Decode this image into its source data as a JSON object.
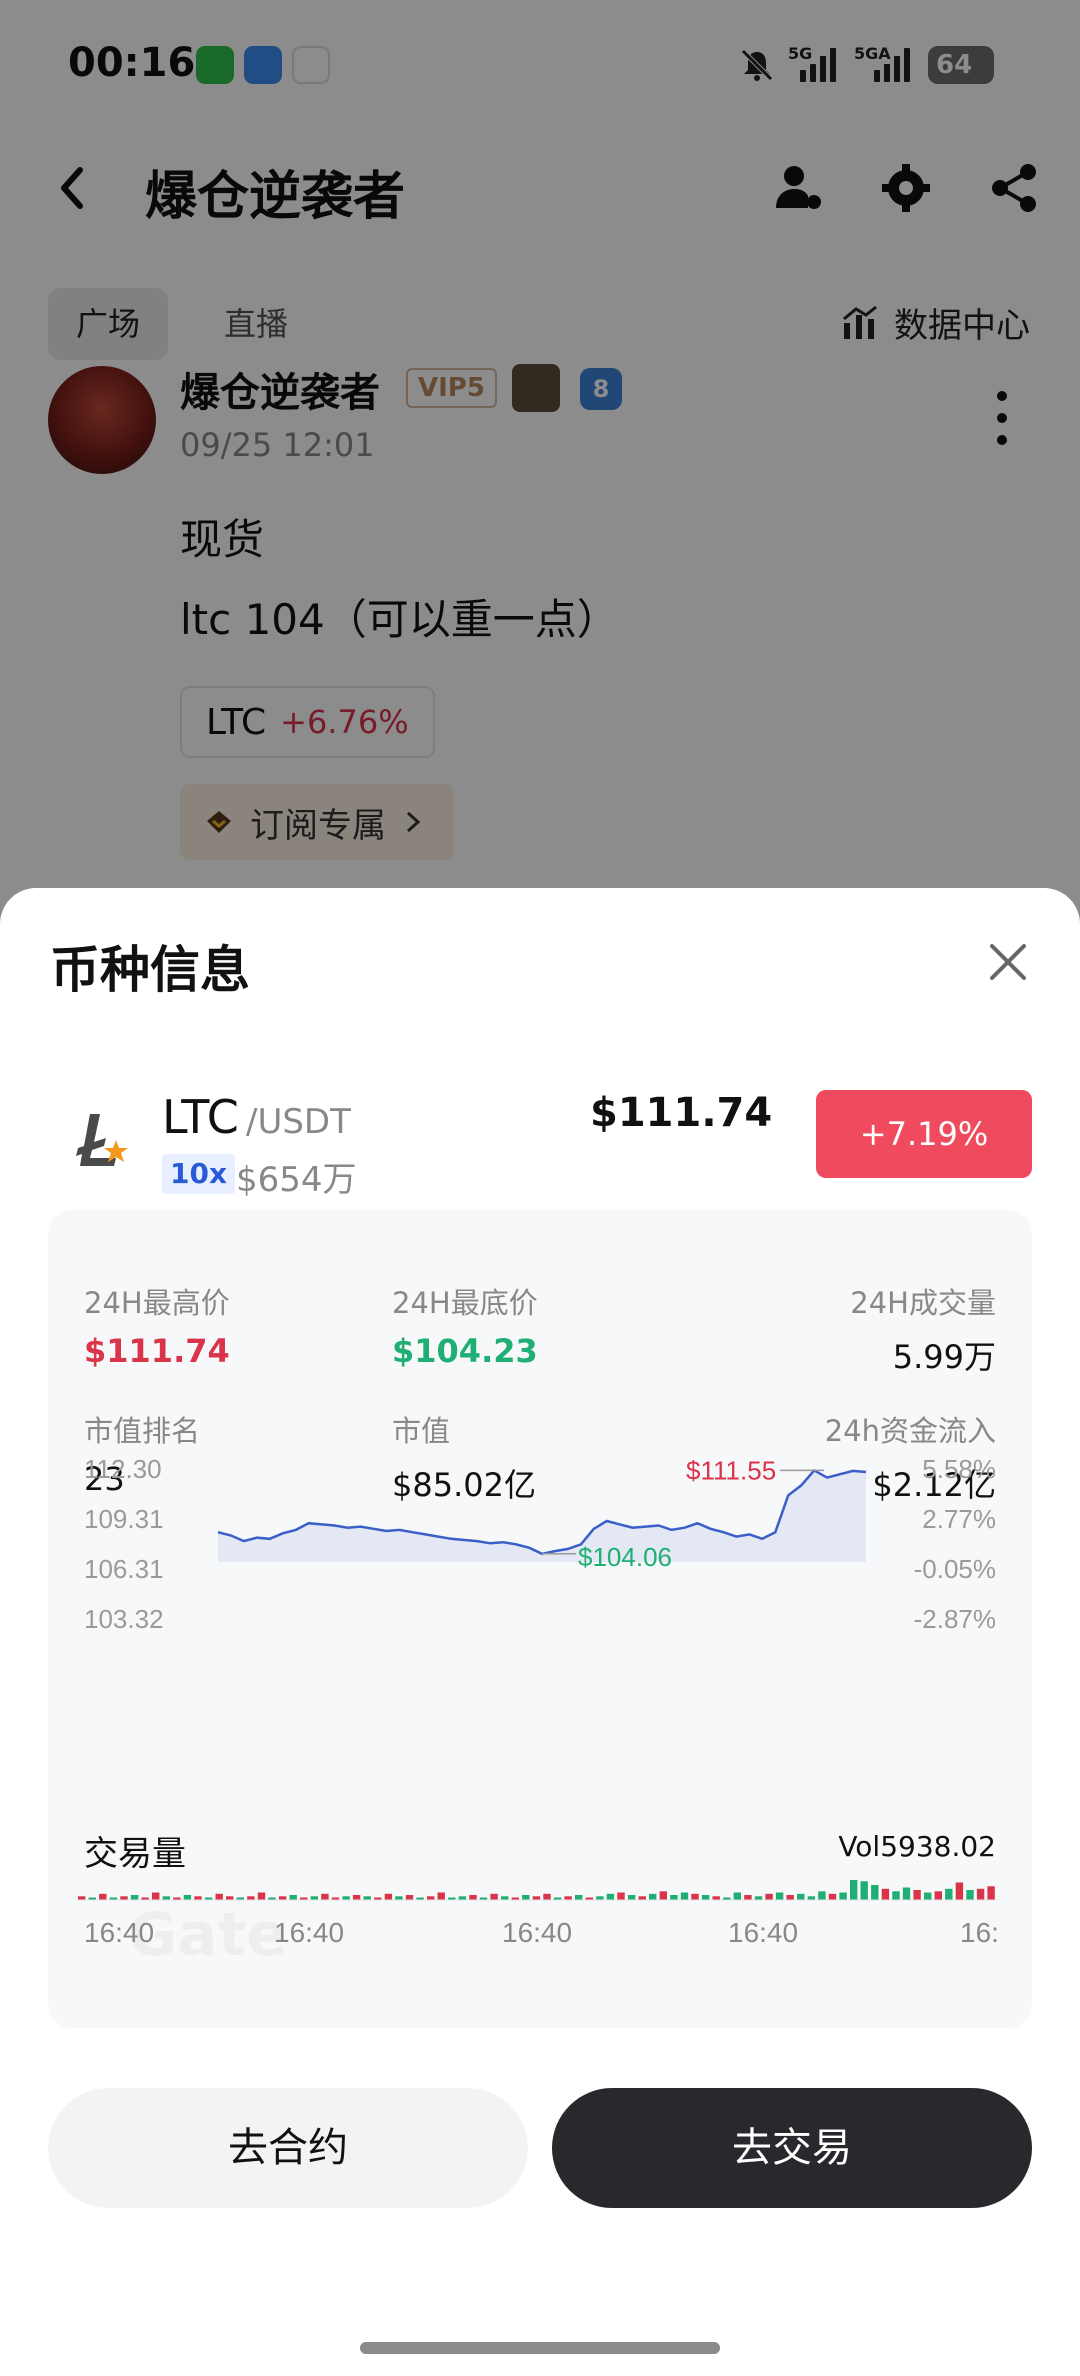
{
  "status": {
    "time": "00:16",
    "net1": "5G",
    "net2": "5GA",
    "battery": "64"
  },
  "header": {
    "title": "爆仓逆袭者"
  },
  "tabs": [
    {
      "label": "广场"
    },
    {
      "label": "直播"
    }
  ],
  "data_center": "数据中心",
  "post": {
    "username": "爆仓逆袭者",
    "vip": "VIP5",
    "level_badge": "8",
    "date": "09/25 12:01",
    "line1": "现货",
    "line2": "ltc  104（可以重一点）",
    "coin_chip": {
      "symbol": "LTC",
      "change": "+6.76%"
    },
    "subscribe_label": "订阅专属"
  },
  "sheet": {
    "title": "币种信息",
    "coin": {
      "symbol": "LTC",
      "pair": "/USDT",
      "leverage": "10x",
      "volume_small": "$654万",
      "price": "$111.74",
      "change": "+7.19%"
    },
    "stats": [
      {
        "label": "24H最高价",
        "value": "$111.74"
      },
      {
        "label": "24H最底价",
        "value": "$104.23"
      },
      {
        "label": "24H成交量",
        "value": "5.99万"
      },
      {
        "label": "市值排名",
        "value": "23"
      },
      {
        "label": "市值",
        "value": "$85.02亿"
      },
      {
        "label": "24h资金流入",
        "value": "$2.12亿"
      }
    ],
    "volume": {
      "label": "交易量",
      "value": "Vol5938.02"
    },
    "watermark": "Gate",
    "buttons": {
      "contract": "去合约",
      "trade": "去交易"
    }
  },
  "colors": {
    "up": "#d9344a",
    "down": "#1fae73",
    "line": "#3a5fc8",
    "trade_button": "#27292c"
  },
  "chart_data": [
    {
      "type": "line",
      "y_ticks_left": [
        "112.30",
        "109.31",
        "106.31",
        "103.32"
      ],
      "y_ticks_right": [
        "5.58%",
        "2.77%",
        "-0.05%",
        "-2.87%"
      ],
      "x_ticks": [
        "16:40",
        "16:40",
        "16:40",
        "16:40",
        "16:"
      ],
      "ylim": [
        103.32,
        112.3
      ],
      "high_label": "$111.55",
      "low_label": "$104.06",
      "high_index": 46,
      "low_index": 25,
      "series": [
        {
          "values": [
            106.0,
            105.7,
            105.2,
            105.5,
            105.4,
            105.9,
            106.2,
            106.8,
            106.7,
            106.6,
            106.4,
            106.5,
            106.3,
            106.1,
            106.2,
            106.0,
            105.8,
            105.6,
            105.4,
            105.3,
            105.2,
            105.0,
            105.1,
            104.9,
            104.6,
            104.06,
            104.3,
            104.5,
            104.9,
            106.3,
            107.0,
            106.7,
            106.4,
            106.5,
            106.6,
            106.2,
            106.4,
            106.8,
            106.3,
            106.0,
            105.6,
            105.8,
            105.4,
            106.0,
            109.3,
            110.2,
            111.55,
            110.9,
            111.2,
            111.5,
            111.4
          ]
        }
      ]
    },
    {
      "type": "bar",
      "values": [
        0.3,
        0.2,
        0.5,
        0.2,
        0.3,
        0.4,
        0.2,
        0.6,
        0.3,
        0.2,
        0.4,
        0.3,
        0.2,
        0.5,
        0.3,
        0.2,
        0.3,
        0.6,
        0.2,
        0.3,
        0.4,
        0.2,
        0.3,
        0.5,
        0.2,
        0.3,
        0.4,
        0.3,
        0.2,
        0.5,
        0.3,
        0.4,
        0.2,
        0.3,
        0.6,
        0.2,
        0.3,
        0.4,
        0.2,
        0.5,
        0.3,
        0.2,
        0.4,
        0.3,
        0.5,
        0.2,
        0.3,
        0.4,
        0.2,
        0.3,
        0.5,
        0.6,
        0.4,
        0.3,
        0.5,
        0.7,
        0.4,
        0.6,
        0.5,
        0.4,
        0.3,
        0.2,
        0.6,
        0.4,
        0.3,
        0.5,
        0.6,
        0.4,
        0.5,
        0.3,
        0.7,
        0.5,
        0.6,
        1.6,
        1.5,
        1.2,
        0.9,
        0.7,
        1.0,
        0.8,
        0.6,
        0.7,
        0.9,
        1.4,
        0.8,
        0.9,
        1.1
      ],
      "colors_up": [
        1,
        0,
        1,
        0,
        1,
        0,
        1,
        1,
        0,
        1,
        0,
        1,
        0,
        1,
        1,
        0,
        1,
        1,
        0,
        1,
        0,
        1,
        0,
        1,
        1,
        0,
        1,
        0,
        1,
        1,
        0,
        1,
        0,
        1,
        1,
        0,
        0,
        1,
        0,
        1,
        0,
        1,
        0,
        1,
        1,
        0,
        1,
        0,
        1,
        0,
        0,
        1,
        0,
        1,
        0,
        1,
        0,
        0,
        1,
        0,
        1,
        0,
        0,
        1,
        0,
        1,
        0,
        1,
        0,
        0,
        0,
        1,
        0,
        0,
        0,
        0,
        1,
        0,
        0,
        1,
        0,
        1,
        0,
        1,
        0,
        1,
        1
      ]
    }
  ]
}
